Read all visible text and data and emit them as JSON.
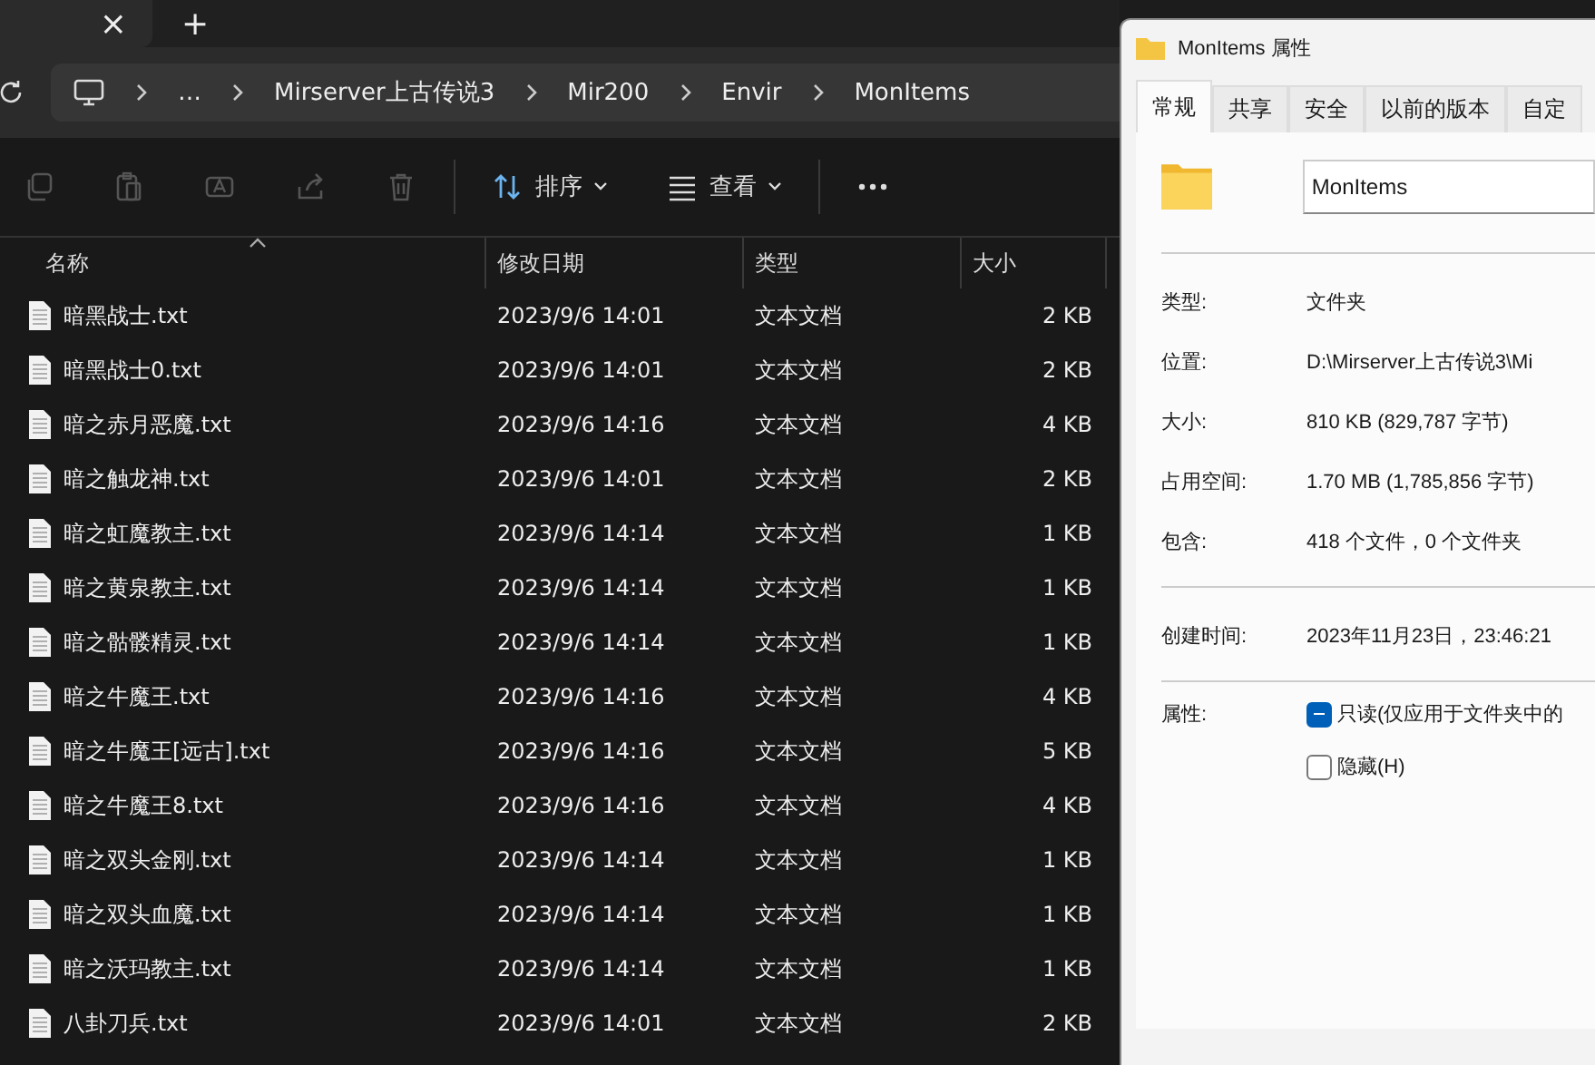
{
  "explorer": {
    "tab_close": "×",
    "new_tab": "+",
    "breadcrumb": [
      "…",
      "Mirserver上古传说3",
      "Mir200",
      "Envir",
      "MonItems"
    ],
    "toolbar": [
      {
        "kind": "copy",
        "disabled": true
      },
      {
        "kind": "paste",
        "disabled": true
      },
      {
        "kind": "rename",
        "disabled": true
      },
      {
        "kind": "share",
        "disabled": true
      },
      {
        "kind": "delete",
        "disabled": true
      },
      {
        "kind": "sort",
        "label": "排序",
        "disabled": false
      },
      {
        "kind": "view",
        "label": "查看",
        "disabled": false
      },
      {
        "kind": "more",
        "disabled": false
      }
    ],
    "columns": [
      "名称",
      "修改日期",
      "类型",
      "大小"
    ],
    "rows": [
      {
        "name": "暗黑战士.txt",
        "date": "2023/9/6 14:01",
        "type": "文本文档",
        "size": "2 KB"
      },
      {
        "name": "暗黑战士0.txt",
        "date": "2023/9/6 14:01",
        "type": "文本文档",
        "size": "2 KB"
      },
      {
        "name": "暗之赤月恶魔.txt",
        "date": "2023/9/6 14:16",
        "type": "文本文档",
        "size": "4 KB"
      },
      {
        "name": "暗之触龙神.txt",
        "date": "2023/9/6 14:01",
        "type": "文本文档",
        "size": "2 KB"
      },
      {
        "name": "暗之虹魔教主.txt",
        "date": "2023/9/6 14:14",
        "type": "文本文档",
        "size": "1 KB"
      },
      {
        "name": "暗之黄泉教主.txt",
        "date": "2023/9/6 14:14",
        "type": "文本文档",
        "size": "1 KB"
      },
      {
        "name": "暗之骷髅精灵.txt",
        "date": "2023/9/6 14:14",
        "type": "文本文档",
        "size": "1 KB"
      },
      {
        "name": "暗之牛魔王.txt",
        "date": "2023/9/6 14:16",
        "type": "文本文档",
        "size": "4 KB"
      },
      {
        "name": "暗之牛魔王[远古].txt",
        "date": "2023/9/6 14:16",
        "type": "文本文档",
        "size": "5 KB"
      },
      {
        "name": "暗之牛魔王8.txt",
        "date": "2023/9/6 14:16",
        "type": "文本文档",
        "size": "4 KB"
      },
      {
        "name": "暗之双头金刚.txt",
        "date": "2023/9/6 14:14",
        "type": "文本文档",
        "size": "1 KB"
      },
      {
        "name": "暗之双头血魔.txt",
        "date": "2023/9/6 14:14",
        "type": "文本文档",
        "size": "1 KB"
      },
      {
        "name": "暗之沃玛教主.txt",
        "date": "2023/9/6 14:14",
        "type": "文本文档",
        "size": "1 KB"
      },
      {
        "name": "八卦刀兵.txt",
        "date": "2023/9/6 14:01",
        "type": "文本文档",
        "size": "2 KB"
      }
    ]
  },
  "properties": {
    "title": "MonItems 属性",
    "tabs": [
      {
        "label": "常规",
        "selected": true
      },
      {
        "label": "共享",
        "selected": false
      },
      {
        "label": "安全",
        "selected": false
      },
      {
        "label": "以前的版本",
        "selected": false
      },
      {
        "label": "自定",
        "selected": false
      }
    ],
    "name_value": "MonItems",
    "groups": [
      [
        {
          "label": "类型:",
          "value": "文件夹"
        },
        {
          "label": "位置:",
          "value": "D:\\Mirserver上古传说3\\Mi"
        },
        {
          "label": "大小:",
          "value": "810 KB (829,787 字节)"
        },
        {
          "label": "占用空间:",
          "value": "1.70 MB (1,785,856 字节)"
        },
        {
          "label": "包含:",
          "value": "418 个文件，0 个文件夹"
        }
      ],
      [
        {
          "label": "创建时间:",
          "value": "2023年11月23日，23:46:21"
        }
      ]
    ],
    "attributes_label": "属性:",
    "attributes": [
      {
        "label": "只读(仅应用于文件夹中的",
        "checked": true,
        "indeterminate": true
      },
      {
        "label": "隐藏(H)",
        "checked": false,
        "indeterminate": false
      }
    ]
  }
}
